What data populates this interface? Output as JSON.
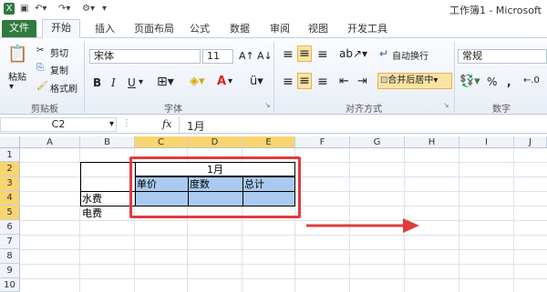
{
  "titlebar": {
    "title": "工作簿1 - Microsoft"
  },
  "tabs": [
    {
      "label": "文件"
    },
    {
      "label": "开始"
    },
    {
      "label": "插入"
    },
    {
      "label": "页面布局"
    },
    {
      "label": "公式"
    },
    {
      "label": "数据"
    },
    {
      "label": "审阅"
    },
    {
      "label": "视图"
    },
    {
      "label": "开发工具"
    }
  ],
  "ribbon": {
    "clipboard": {
      "paste": "粘贴",
      "cut": "剪切",
      "copy": "复制",
      "format_painter": "格式刷",
      "group": "剪贴板"
    },
    "font": {
      "name": "宋体",
      "size": "11",
      "bold": "B",
      "italic": "I",
      "underline": "U",
      "font_color": "A",
      "group": "字体"
    },
    "alignment": {
      "wrap": "自动换行",
      "merge": "合并后居中",
      "group": "对齐方式"
    },
    "number": {
      "format": "常规",
      "percent": "%",
      "comma": ",",
      "group": "数字"
    }
  },
  "formula_bar": {
    "name_box": "C2",
    "fx": "fx",
    "content": "1月"
  },
  "grid": {
    "columns": [
      "A",
      "B",
      "C",
      "D",
      "E",
      "F",
      "G",
      "H",
      "I",
      "J"
    ],
    "rows": [
      "1",
      "2",
      "3",
      "4",
      "5",
      "6",
      "7",
      "8",
      "9",
      "10"
    ],
    "cells": {
      "merged_month": "1月",
      "header_price": "单价",
      "header_qty": "度数",
      "header_total": "总计",
      "row_water": "水费",
      "row_electric": "电费"
    }
  },
  "colors": {
    "selection": "#f8d56e",
    "table_fill": "#a9cbef",
    "highlight_border": "#e03c3c",
    "file_tab": "#2f7a3d"
  }
}
